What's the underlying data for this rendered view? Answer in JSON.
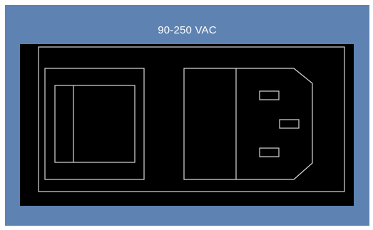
{
  "power_inlet": {
    "voltage_label": "90-250 VAC"
  },
  "colors": {
    "panel_background": "#5e82b1",
    "inlet_body": "#000000",
    "outline": "#d8d8d8",
    "label_text": "#ffffff"
  },
  "icons": {
    "power_switch": "rocker-switch-icon",
    "iec_connector": "iec-c14-socket-icon"
  }
}
